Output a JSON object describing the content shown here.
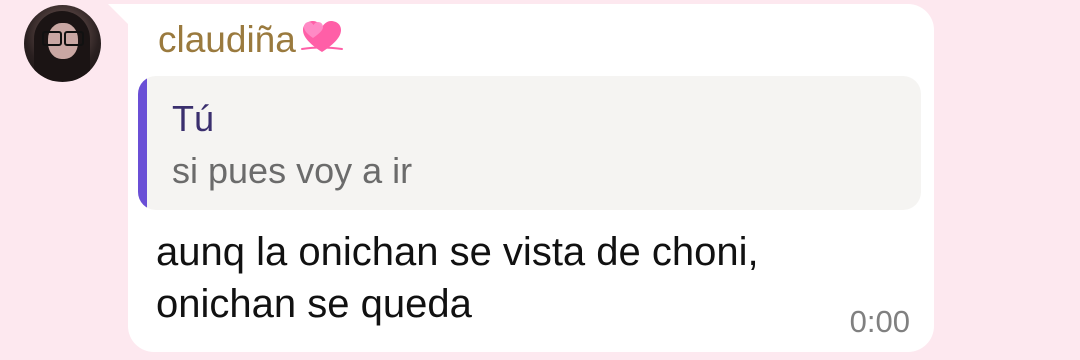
{
  "chat": {
    "sender_name": "claudiña",
    "sender_emoji_icon": "two-hearts-icon",
    "reply": {
      "author": "Tú",
      "text": "si pues voy a ir"
    },
    "message_lines": [
      "aunq la onichan se vista de choni,",
      "onichan se queda"
    ],
    "time": "0:00"
  },
  "colors": {
    "background": "#fde8ef",
    "bubble": "#ffffff",
    "sender_name": "#9a7a3e",
    "quote_background": "#f5f4f2",
    "quote_bar": "#6a4fd6",
    "quote_author": "#3a2f6e",
    "quote_text": "#6b6b6b",
    "message_text": "#111111",
    "time": "#808080"
  }
}
